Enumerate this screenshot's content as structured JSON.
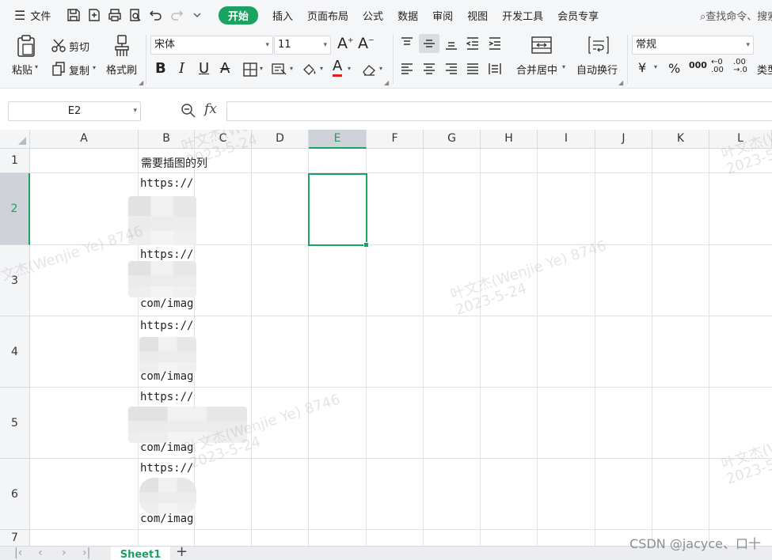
{
  "menubar": {
    "file_label": "文件",
    "tabs": [
      "开始",
      "插入",
      "页面布局",
      "公式",
      "数据",
      "审阅",
      "视图",
      "开发工具",
      "会员专享"
    ],
    "active_tab": "开始",
    "search_placeholder": "查找命令、搜索模板"
  },
  "ribbon": {
    "paste_label": "粘贴",
    "cut_label": "剪切",
    "copy_label": "复制",
    "format_painter_label": "格式刷",
    "font_name": "宋体",
    "font_size": "11",
    "merge_label": "合并居中",
    "wrap_label": "自动换行",
    "number_format": "常规",
    "currency_symbol": "¥",
    "percent_symbol": "%",
    "thousands_symbol": "000",
    "type_convert_label": "类型"
  },
  "formula": {
    "namebox_value": "E2",
    "fx_label": "fx",
    "formula_value": ""
  },
  "grid": {
    "columns": [
      "A",
      "B",
      "C",
      "D",
      "E",
      "F",
      "G",
      "H",
      "I",
      "J",
      "K",
      "L"
    ],
    "selected_column": "E",
    "rows": [
      "1",
      "2",
      "3",
      "4",
      "5",
      "6",
      "7"
    ],
    "selected_row": "2",
    "b1": "需要插图的列",
    "b_cells": [
      {
        "line1": "https://",
        "line2": ""
      },
      {
        "line1": "https://",
        "line2": "com/imag"
      },
      {
        "line1": "https://",
        "line2": "com/imag"
      },
      {
        "line1": "https://",
        "line2": "com/imag"
      },
      {
        "line1": "https://",
        "line2": "com/imag"
      }
    ]
  },
  "watermark": {
    "line1": "叶文杰(Wenjie Ye) 8746",
    "line2": "2023-5-24"
  },
  "sheets": {
    "tabs": [
      "Sheet1"
    ],
    "active": "Sheet1",
    "add_label": "+"
  },
  "footer": {
    "credit": "CSDN @jacyce、口十"
  },
  "colors": {
    "accent": "#1aa262",
    "gridline": "#dfe1e5",
    "header_bg": "#f4f5f7"
  }
}
